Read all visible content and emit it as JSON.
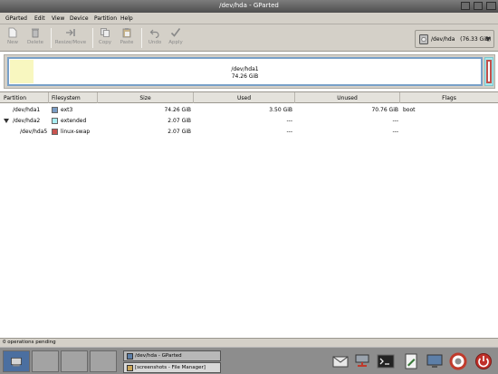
{
  "window": {
    "title": "/dev/hda - GParted"
  },
  "menu": [
    "GParted",
    "Edit",
    "View",
    "Device",
    "Partition",
    "Help"
  ],
  "toolbar": {
    "new": "New",
    "delete": "Delete",
    "resize": "Resize/Move",
    "copy": "Copy",
    "paste": "Paste",
    "undo": "Undo",
    "apply": "Apply"
  },
  "device_selector": {
    "device": "/dev/hda",
    "size": "(76.33 GiB)",
    "icon": "disk-icon"
  },
  "disk_map": {
    "name": "/dev/hda1",
    "size": "74.26 GiB",
    "used_fraction": 0.047
  },
  "table": {
    "headers": [
      "Partition",
      "Filesystem",
      "Size",
      "Used",
      "Unused",
      "Flags"
    ],
    "rows": [
      {
        "partition": "/dev/hda1",
        "filesystem": "ext3",
        "color": "#7a9cc4",
        "size": "74.26 GiB",
        "used": "3.50 GiB",
        "unused": "70.76 GiB",
        "flags": "boot"
      },
      {
        "partition": "/dev/hda2",
        "filesystem": "extended",
        "color": "#a8eef2",
        "size": "2.07 GiB",
        "used": "---",
        "unused": "---",
        "flags": ""
      },
      {
        "partition": "/dev/hda5",
        "filesystem": "linux-swap",
        "color": "#c9534f",
        "size": "2.07 GiB",
        "used": "---",
        "unused": "---",
        "flags": ""
      }
    ]
  },
  "status": "0 operations pending",
  "taskbar": {
    "tasks": [
      "/dev/hda - GParted",
      "[screenshots - File Manager]"
    ],
    "tray_icons": [
      "mail-icon",
      "network-icon",
      "terminal-icon",
      "editor-icon",
      "monitor-icon",
      "lifebuoy-icon",
      "power-icon"
    ]
  }
}
